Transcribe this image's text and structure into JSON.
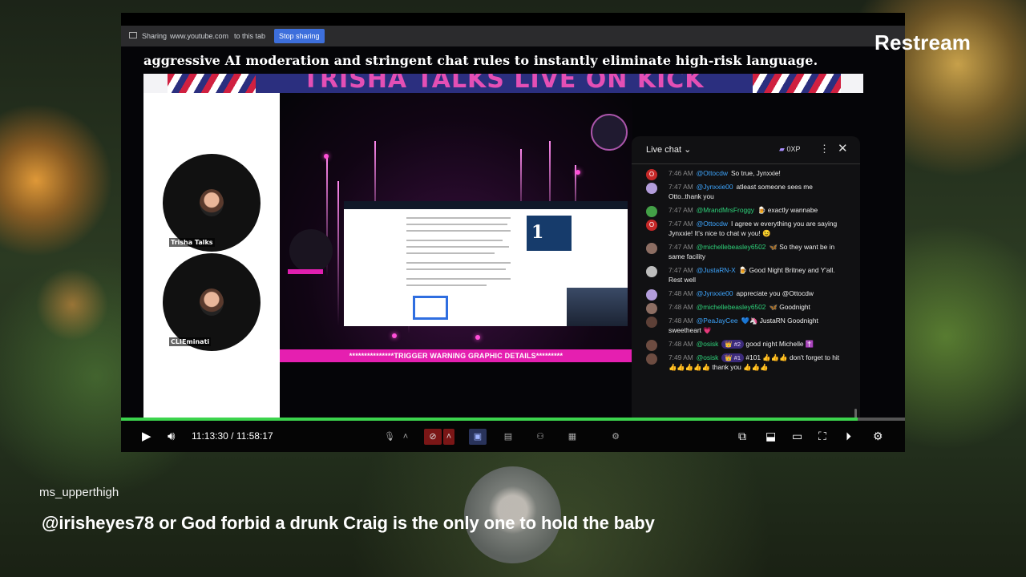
{
  "share_bar": {
    "sharing_label": "Sharing",
    "domain": "www.youtube.com",
    "to_tab": "to this tab",
    "stop_button": "Stop sharing"
  },
  "stream": {
    "caption": "aggressive AI moderation and stringent chat rules to instantly eliminate high-risk language.",
    "banner_title": "TRISHA TALKS LIVE ON KICK",
    "cam1_name": "Trisha Talks",
    "cam2_name": "CLIEminati",
    "trigger_warning": "***************TRIGGER WARNING GRAPHIC DETAILS*********",
    "news_number": "1"
  },
  "player": {
    "time": "11:13:30 / 11:58:17",
    "progress_fraction": 0.94
  },
  "chat": {
    "title": "Live chat",
    "xp": "0XP",
    "messages": [
      {
        "time": "7:46 AM",
        "author": "@Ottocdw",
        "text": "So true, Jynxxie!",
        "avatar": "O",
        "color": "#c62828"
      },
      {
        "time": "7:47 AM",
        "author": "@Jynxxie00",
        "text": "atleast someone sees me Otto..thank you",
        "avatar": "",
        "color": "#b39ddb"
      },
      {
        "time": "7:47 AM",
        "author": "@MrandMrsFroggy",
        "text": "🍺 exactly wannabe",
        "avatar": "",
        "color": "#43a047"
      },
      {
        "time": "7:47 AM",
        "author": "@Ottocdw",
        "text": "I agree w everything you are saying Jynxxie! It's nice to chat w you! 😉",
        "avatar": "O",
        "color": "#c62828"
      },
      {
        "time": "7:47 AM",
        "author": "@michellebeasley6502",
        "text": "🦋 So they want be in same facility",
        "avatar": "",
        "color": "#8d6e63"
      },
      {
        "time": "7:47 AM",
        "author": "@JustaRN-X",
        "text": "🍺 Good Night Britney and Y'all. Rest well",
        "avatar": "",
        "color": "#bdbdbd"
      },
      {
        "time": "7:48 AM",
        "author": "@Jynxxie00",
        "text": "appreciate you @Ottocdw",
        "avatar": "",
        "color": "#b39ddb"
      },
      {
        "time": "7:48 AM",
        "author": "@michellebeasley6502",
        "text": "🦋 Goodnight",
        "avatar": "",
        "color": "#8d6e63"
      },
      {
        "time": "7:48 AM",
        "author": "@PeaJayCee",
        "text": "💙🦄 JustaRN Goodnight sweetheart 💗",
        "avatar": "",
        "color": "#5d4037"
      },
      {
        "time": "7:48 AM",
        "author": "@osisk",
        "badge": "👑 #2",
        "text": "good night Michelle ✝️",
        "avatar": "",
        "color": "#6d4c41"
      },
      {
        "time": "7:49 AM",
        "author": "@osisk",
        "badge": "👑 #1",
        "text": "#101 👍👍👍 don't forget to hit 👍👍👍👍👍 thank you 👍👍👍",
        "avatar": "",
        "color": "#6d4c41"
      }
    ]
  },
  "overlay": {
    "brand": "Restream",
    "username": "ms_upperthigh",
    "comment": "@irisheyes78 or God forbid a drunk Craig is the only one to hold the baby"
  }
}
